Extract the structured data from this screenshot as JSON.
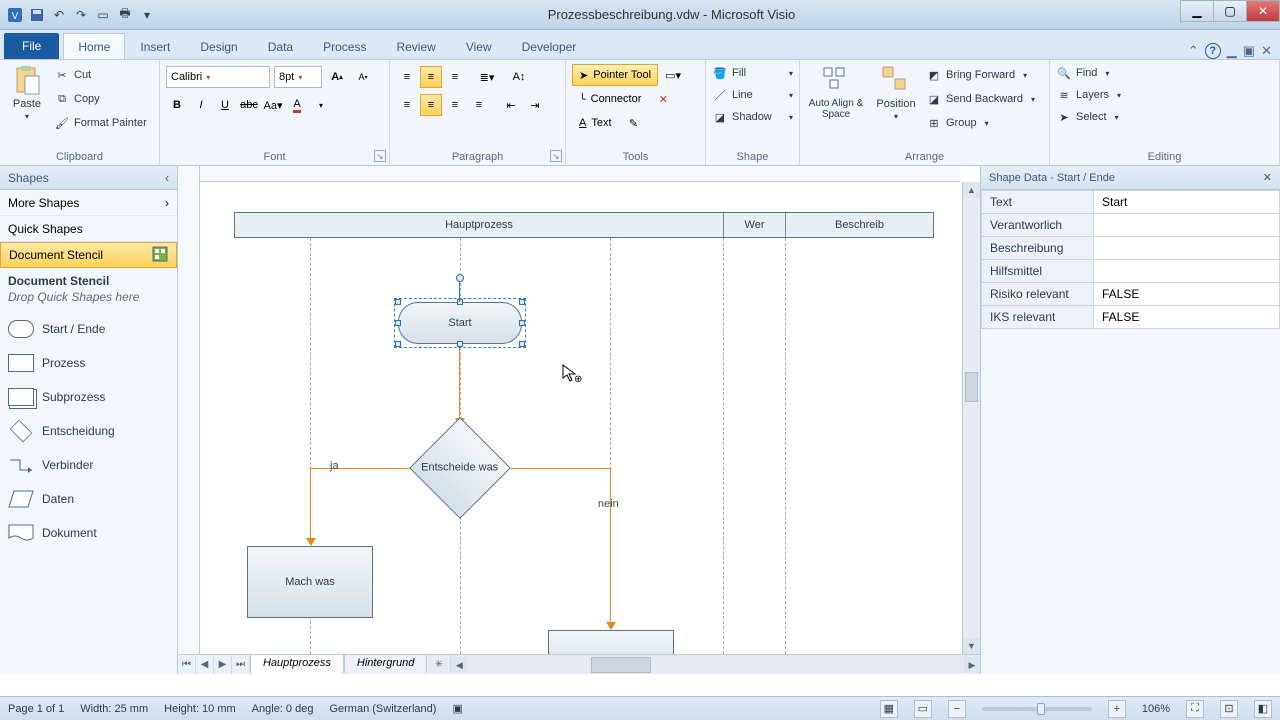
{
  "app": {
    "title": "Prozessbeschreibung.vdw - Microsoft Visio"
  },
  "tabs": {
    "file": "File",
    "items": [
      "Home",
      "Insert",
      "Design",
      "Data",
      "Process",
      "Review",
      "View",
      "Developer"
    ],
    "active": 0
  },
  "ribbon": {
    "clipboard": {
      "paste": "Paste",
      "cut": "Cut",
      "copy": "Copy",
      "format_painter": "Format Painter",
      "label": "Clipboard"
    },
    "font": {
      "name": "Calibri",
      "size": "8pt",
      "label": "Font"
    },
    "paragraph": {
      "label": "Paragraph"
    },
    "tools": {
      "pointer": "Pointer Tool",
      "connector": "Connector",
      "text": "Text",
      "label": "Tools"
    },
    "shape": {
      "fill": "Fill",
      "line": "Line",
      "shadow": "Shadow",
      "label": "Shape"
    },
    "arrange": {
      "autoalign": "Auto Align & Space",
      "position": "Position",
      "bring_forward": "Bring Forward",
      "send_backward": "Send Backward",
      "group": "Group",
      "label": "Arrange"
    },
    "editing": {
      "find": "Find",
      "layers": "Layers",
      "select": "Select",
      "label": "Editing"
    }
  },
  "shapes_panel": {
    "title": "Shapes",
    "more": "More Shapes",
    "quick": "Quick Shapes",
    "docstencil": "Document Stencil",
    "section_title": "Document Stencil",
    "hint": "Drop Quick Shapes here",
    "items": [
      "Start / Ende",
      "Prozess",
      "Subprozess",
      "Entscheidung",
      "Verbinder",
      "Daten",
      "Dokument"
    ]
  },
  "swimlane": {
    "cols": [
      "Hauptprozess",
      "Wer",
      "Beschreib"
    ]
  },
  "flowchart": {
    "start": "Start",
    "decision": "Entscheide was",
    "yes": "ja",
    "no": "nein",
    "process": "Mach was"
  },
  "sheets": {
    "main": "Hauptprozess",
    "bg": "Hintergrund"
  },
  "shape_data": {
    "title": "Shape Data - Start / Ende",
    "rows": [
      {
        "k": "Text",
        "v": "Start"
      },
      {
        "k": "Verantworlich",
        "v": ""
      },
      {
        "k": "Beschreibung",
        "v": ""
      },
      {
        "k": "Hilfsmittel",
        "v": ""
      },
      {
        "k": "Risiko relevant",
        "v": "FALSE"
      },
      {
        "k": "IKS relevant",
        "v": "FALSE"
      }
    ]
  },
  "status": {
    "page": "Page 1 of 1",
    "width": "Width: 25 mm",
    "height": "Height: 10 mm",
    "angle": "Angle: 0 deg",
    "lang": "German (Switzerland)",
    "zoom": "106%"
  }
}
